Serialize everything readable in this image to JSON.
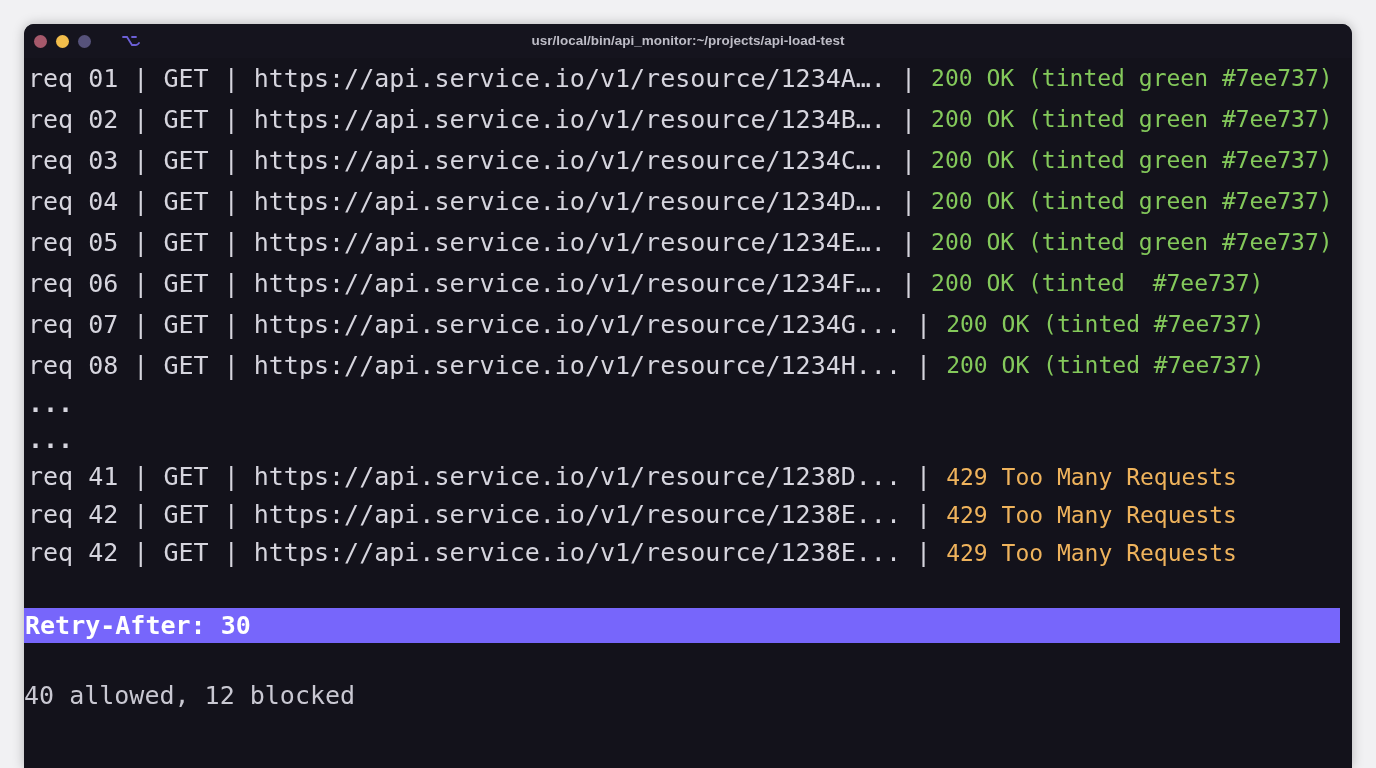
{
  "window": {
    "title": "usr/local/bin/api_monitor:~/projects/api-load-test"
  },
  "log": [
    {
      "kind": "request",
      "request": "req 01 | GET | https://api.service.io/v1/resource/1234A…. |",
      "status": "200 OK (tinted green #7ee737)",
      "color": "#84c95b"
    },
    {
      "kind": "request",
      "request": "req 02 | GET | https://api.service.io/v1/resource/1234B…. |",
      "status": "200 OK (tinted green #7ee737)",
      "color": "#84c95b"
    },
    {
      "kind": "request",
      "request": "req 03 | GET | https://api.service.io/v1/resource/1234C…. |",
      "status": "200 OK (tinted green #7ee737)",
      "color": "#84c95b"
    },
    {
      "kind": "request",
      "request": "req 04 | GET | https://api.service.io/v1/resource/1234D…. |",
      "status": "200 OK (tinted green #7ee737)",
      "color": "#84c95b"
    },
    {
      "kind": "request",
      "request": "req 05 | GET | https://api.service.io/v1/resource/1234E…. |",
      "status": "200 OK (tinted green #7ee737)",
      "color": "#84c95b"
    },
    {
      "kind": "request",
      "request": "req 06 | GET | https://api.service.io/v1/resource/1234F…. |",
      "status": "200 OK (tinted  #7ee737)",
      "color": "#84c95b"
    },
    {
      "kind": "request",
      "request": "req 07 | GET | https://api.service.io/v1/resource/1234G... |",
      "status": "200 OK (tinted #7ee737)",
      "color": "#84c95b"
    },
    {
      "kind": "request",
      "request": "req 08 | GET | https://api.service.io/v1/resource/1234H... |",
      "status": "200 OK (tinted #7ee737)",
      "color": "#84c95b"
    },
    {
      "kind": "ellipsis",
      "text": "..."
    },
    {
      "kind": "ellipsis",
      "text": "..."
    },
    {
      "kind": "request",
      "request": "req 41 | GET | https://api.service.io/v1/resource/1238D... |",
      "status": "429 Too Many Requests",
      "color": "#efb35c"
    },
    {
      "kind": "request",
      "request": "req 42 | GET | https://api.service.io/v1/resource/1238E... |",
      "status": "429 Too Many Requests",
      "color": "#efb35c"
    },
    {
      "kind": "request",
      "request": "req 42 | GET | https://api.service.io/v1/resource/1238E... |",
      "status": "429 Too Many Requests",
      "color": "#efb35c"
    }
  ],
  "banner": {
    "text": "Retry-After: 30"
  },
  "summary": "40 allowed, 12 blocked"
}
